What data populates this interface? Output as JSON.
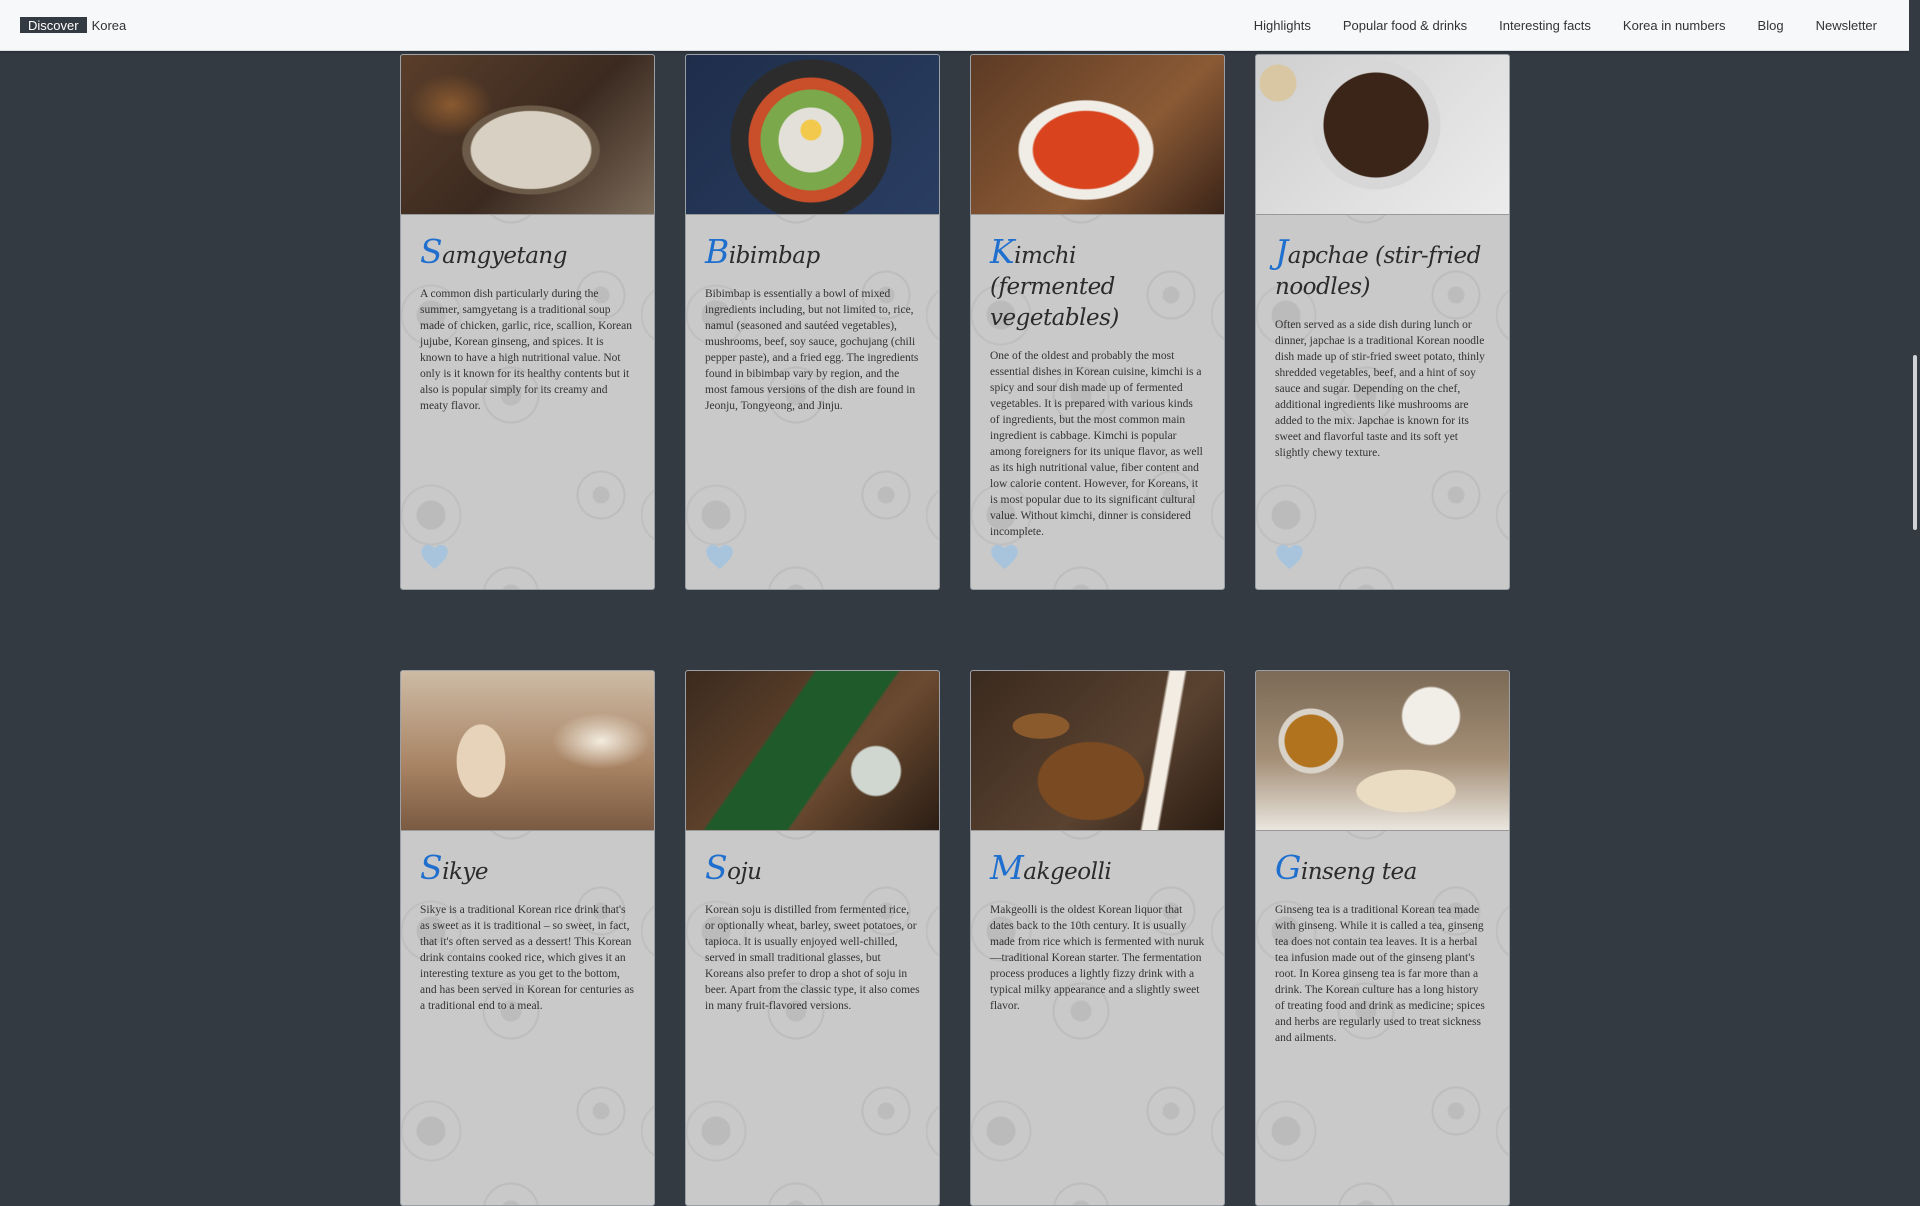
{
  "brand": {
    "box": "Discover",
    "text": "Korea"
  },
  "nav": {
    "links": [
      "Highlights",
      "Popular food & drinks",
      "Interesting facts",
      "Korea in numbers",
      "Blog",
      "Newsletter"
    ]
  },
  "cards": [
    {
      "initial": "S",
      "rest": "amgyetang",
      "text": "A common dish particularly during the summer, samgyetang is a traditional soup made of chicken, garlic, rice, scallion, Korean jujube, Korean ginseng, and spices. It is known to have a high nutritional value. Not only is it known for its healthy contents but it also is popular simply for its creamy and meaty flavor."
    },
    {
      "initial": "B",
      "rest": "ibimbap",
      "text": "Bibimbap is essentially a bowl of mixed ingredients including, but not limited to, rice, namul (seasoned and sautéed vegetables), mushrooms, beef, soy sauce, gochujang (chili pepper paste), and a fried egg. The ingredients found in bibimbap vary by region, and the most famous versions of the dish are found in Jeonju, Tongyeong, and Jinju."
    },
    {
      "initial": "K",
      "rest": "imchi (fermented vegetables)",
      "text": "One of the oldest and probably the most essential dishes in Korean cuisine, kimchi is a spicy and sour dish made up of fermented vegetables. It is prepared with various kinds of ingredients, but the most common main ingredient is cabbage. Kimchi is popular among foreigners for its unique flavor, as well as its high nutritional value, fiber content and low calorie content. However, for Koreans, it is most popular due to its significant cultural value. Without kimchi, dinner is considered incomplete."
    },
    {
      "initial": "J",
      "rest": "apchae (stir-fried noodles)",
      "text": "Often served as a side dish during lunch or dinner, japchae is a traditional Korean noodle dish made up of stir-fried sweet potato, thinly shredded vegetables, beef, and a hint of soy sauce and sugar. Depending on the chef, additional ingredients like mushrooms are added to the mix. Japchae is known for its sweet and flavorful taste and its soft yet slightly chewy texture."
    },
    {
      "initial": "S",
      "rest": "ikye",
      "text": "Sikye is a traditional Korean rice drink that's as sweet as it is traditional – so sweet, in fact, that it's often served as a dessert! This Korean drink contains cooked rice, which gives it an interesting texture as you get to the bottom, and has been served in Korean for centuries as a traditional end to a meal."
    },
    {
      "initial": "S",
      "rest": "oju",
      "text": "Korean soju is distilled from fermented rice, or optionally wheat, barley, sweet potatoes, or tapioca. It is usually enjoyed well-chilled, served in small traditional glasses, but Koreans also prefer to drop a shot of soju in beer. Apart from the classic type, it also comes in many fruit-flavored versions."
    },
    {
      "initial": "M",
      "rest": "akgeolli",
      "text": "Makgeolli is the oldest Korean liquor that dates back to the 10th century. It is usually made from rice which is fermented with nuruk—traditional Korean starter. The fermentation process produces a lightly fizzy drink with a typical milky appearance and a slightly sweet flavor."
    },
    {
      "initial": "G",
      "rest": "inseng tea",
      "text": "Ginseng tea is a traditional Korean tea made with ginseng. While it is called a tea, ginseng tea does not contain tea leaves. It is a herbal tea infusion made out of the ginseng plant's root. In Korea ginseng tea is far more than a drink. The Korean culture has a long history of treating food and drink as medicine; spices and herbs are regularly used to treat sickness and ailments."
    }
  ],
  "colors": {
    "accent": "#1f6fcf",
    "heart": "#a8c4dc",
    "page_bg": "#343a42"
  }
}
